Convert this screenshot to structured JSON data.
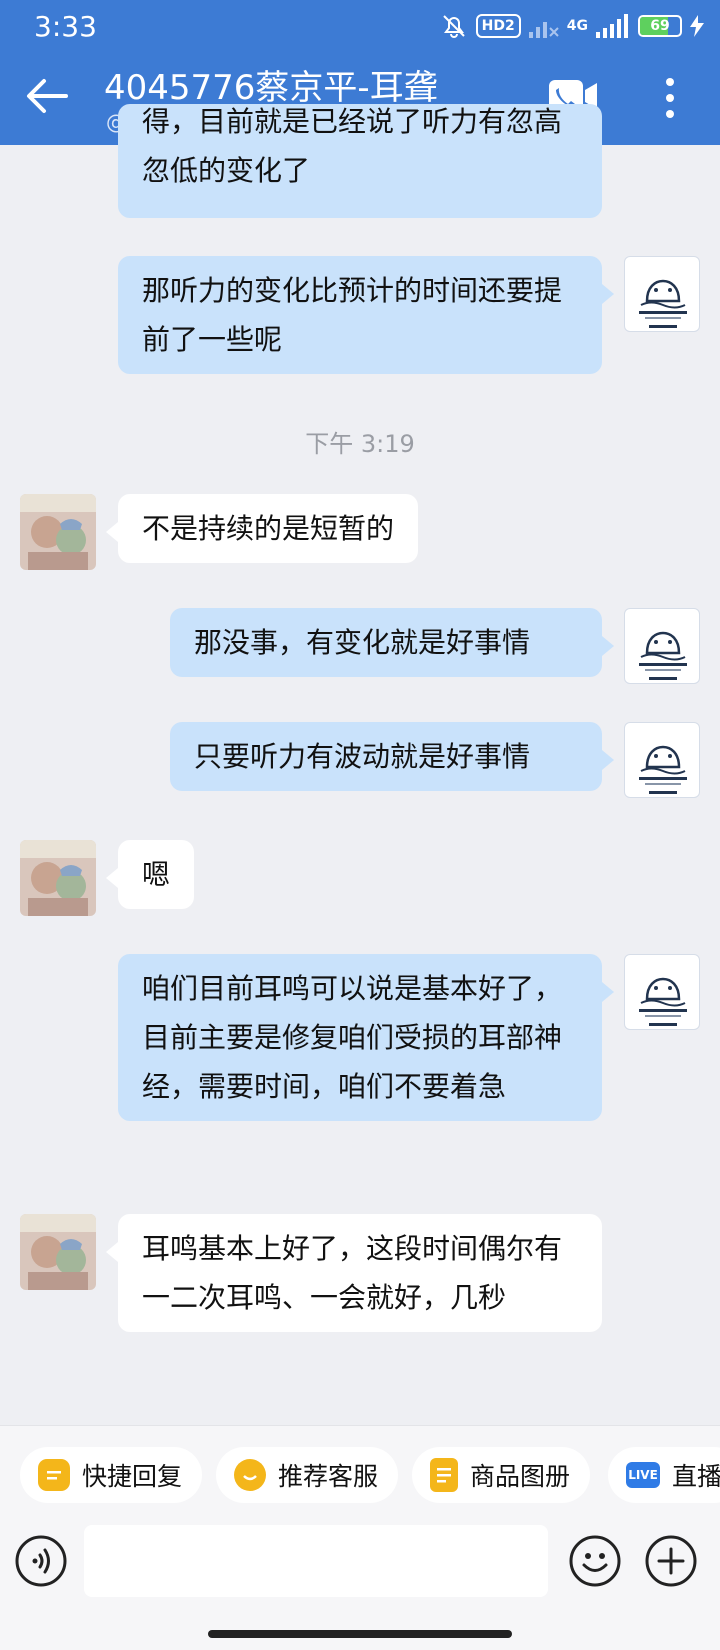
{
  "status_bar": {
    "time": "3:33",
    "hd_label": "HD2",
    "network_label": "4G",
    "battery_level": "69"
  },
  "header": {
    "title": "4045776蔡京平-耳聋",
    "subtitle": "@微信"
  },
  "messages": [
    {
      "direction": "out",
      "text": "得，目前就是已经说了听力有忽高忽低的变化了"
    },
    {
      "direction": "out",
      "text": "那听力的变化比预计的时间还要提前了一些呢"
    },
    {
      "timestamp": "下午 3:19"
    },
    {
      "direction": "in",
      "text": "不是持续的是短暂的"
    },
    {
      "direction": "out",
      "text": "那没事，有变化就是好事情"
    },
    {
      "direction": "out",
      "text": "只要听力有波动就是好事情"
    },
    {
      "direction": "in",
      "text": "嗯"
    },
    {
      "direction": "out",
      "text": "咱们目前耳鸣可以说是基本好了，目前主要是修复咱们受损的耳部神经，需要时间，咱们不要着急"
    },
    {
      "direction": "in",
      "text": "耳鸣基本上好了，这段时间偶尔有一二次耳鸣、一会就好，几秒"
    }
  ],
  "quick_actions": [
    {
      "label": "快捷回复",
      "icon": "quick-reply-icon"
    },
    {
      "label": "推荐客服",
      "icon": "recommend-service-icon"
    },
    {
      "label": "商品图册",
      "icon": "product-album-icon"
    },
    {
      "label": "直播",
      "icon": "live-icon",
      "icon_text": "LIVE"
    }
  ],
  "input": {
    "placeholder": ""
  },
  "colors": {
    "header": "#3d7bd4",
    "outgoing_bubble": "#c9e2fb",
    "incoming_bubble": "#ffffff",
    "chip_icon": "#f4b61a",
    "live_icon": "#2f7be6"
  }
}
